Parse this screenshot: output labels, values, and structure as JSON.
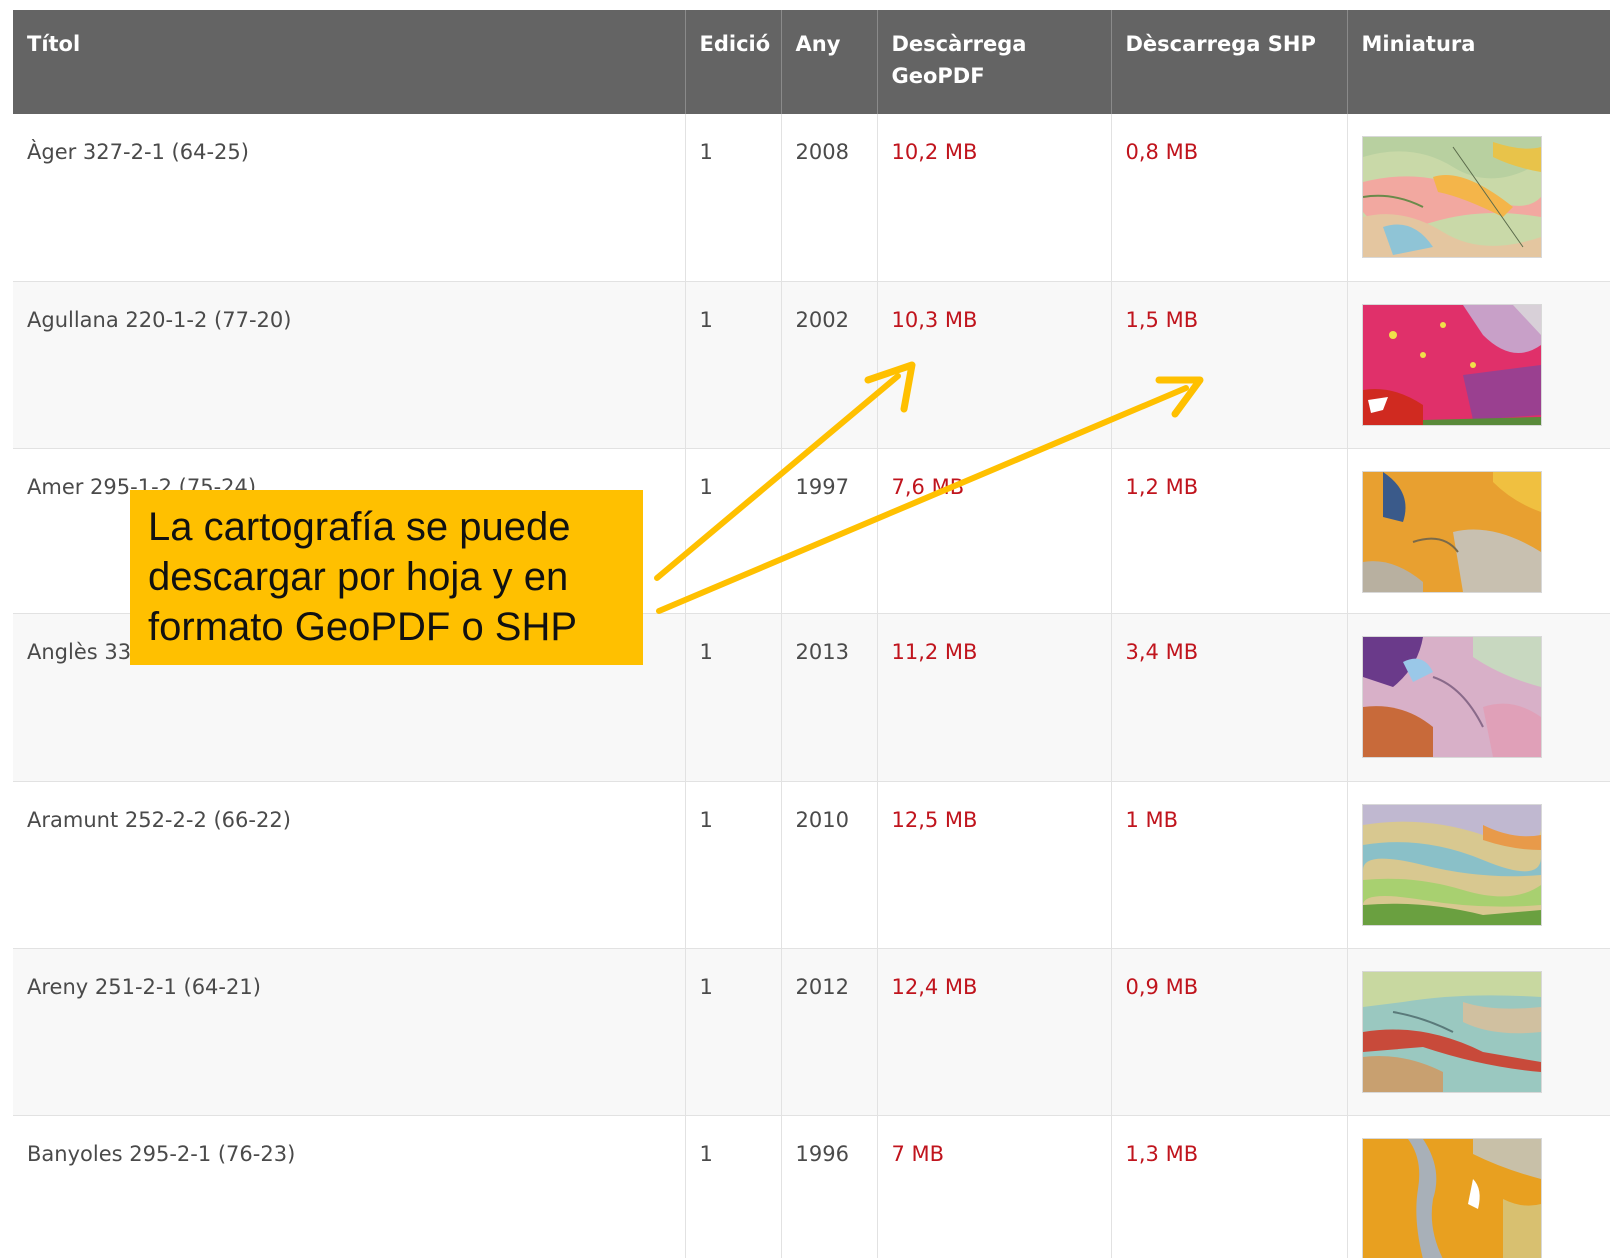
{
  "table": {
    "headers": {
      "title": "Títol",
      "edition": "Edició",
      "year": "Any",
      "geopdf": "Descàrrega GeoPDF",
      "shp": "Dèscarrega SHP",
      "thumbnail": "Miniatura"
    },
    "rows": [
      {
        "title": "Àger 327-2-1 (64-25)",
        "edition": "1",
        "year": "2008",
        "geopdf": "10,2 MB",
        "shp": "0,8 MB"
      },
      {
        "title": "Agullana 220-1-2 (77-20)",
        "edition": "1",
        "year": "2002",
        "geopdf": "10,3 MB",
        "shp": "1,5 MB"
      },
      {
        "title": "Amer 295-1-2 (75-24)",
        "edition": "1",
        "year": "1997",
        "geopdf": "7,6 MB",
        "shp": "1,2 MB"
      },
      {
        "title": "Anglès 33",
        "edition": "1",
        "year": "2013",
        "geopdf": "11,2 MB",
        "shp": "3,4 MB"
      },
      {
        "title": "Aramunt 252-2-2 (66-22)",
        "edition": "1",
        "year": "2010",
        "geopdf": "12,5 MB",
        "shp": "1 MB"
      },
      {
        "title": "Areny 251-2-1 (64-21)",
        "edition": "1",
        "year": "2012",
        "geopdf": "12,4 MB",
        "shp": "0,9 MB"
      },
      {
        "title": "Banyoles 295-2-1 (76-23)",
        "edition": "1",
        "year": "1996",
        "geopdf": "7 MB",
        "shp": "1,3 MB"
      }
    ]
  },
  "callout": {
    "text": "La cartografía se puede descargar por hoja y en formato GeoPDF o SHP",
    "color": "#ffc000"
  },
  "colors": {
    "header_bg": "#646464",
    "link": "#c0141d",
    "arrow": "#ffc000"
  }
}
